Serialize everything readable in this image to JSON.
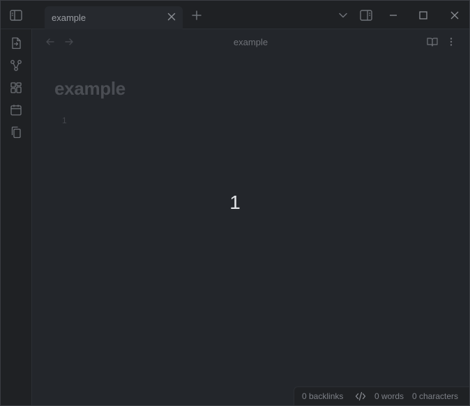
{
  "tab": {
    "label": "example"
  },
  "view": {
    "title": "example"
  },
  "document": {
    "heading": "example",
    "line_number": "1"
  },
  "overlay": {
    "value": "1"
  },
  "status": {
    "backlinks": "0 backlinks",
    "words": "0 words",
    "characters": "0 characters"
  },
  "icons": {
    "sidebar_toggle": "sidebar-toggle-icon",
    "tab_close": "close-icon",
    "new_tab": "plus-icon",
    "tab_list": "chevron-down-icon",
    "right_sidebar": "right-sidebar-icon",
    "minimize": "minimize-icon",
    "maximize": "maximize-icon",
    "close_window": "close-icon",
    "back": "arrow-left-icon",
    "forward": "arrow-right-icon",
    "reading_view": "book-open-icon",
    "more": "more-vertical-icon",
    "ribbon": [
      "file-switch-icon",
      "graph-icon",
      "canvas-icon",
      "calendar-icon",
      "copy-icon"
    ],
    "source_mode": "code-icon"
  },
  "colors": {
    "background": "#23262b",
    "chrome": "#1f2124",
    "icon": "#6f7278"
  }
}
